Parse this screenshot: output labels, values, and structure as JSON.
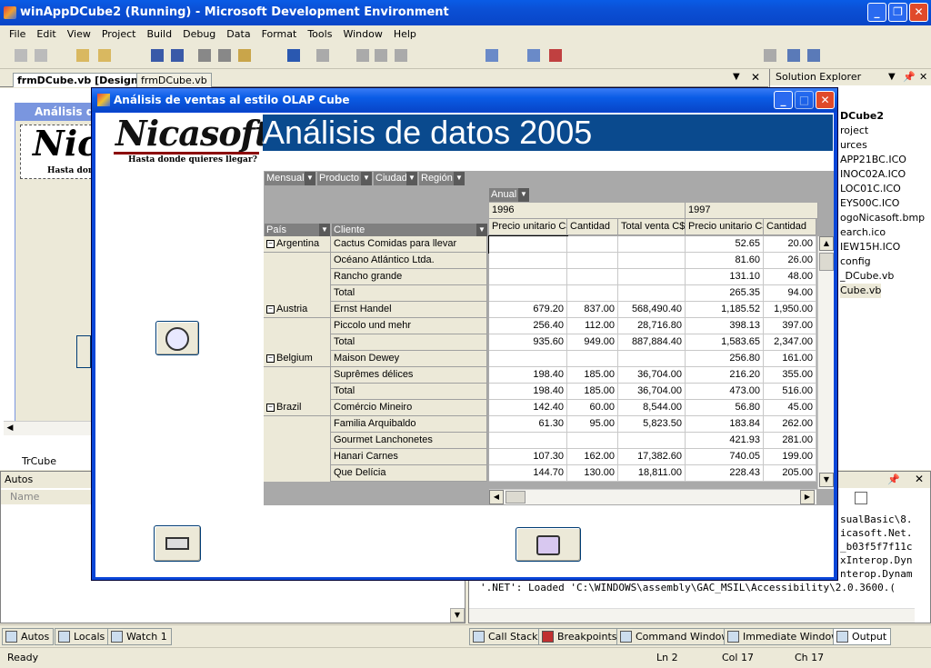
{
  "ide": {
    "title": "winAppDCube2 (Running) - Microsoft Development Environment",
    "menu": [
      "File",
      "Edit",
      "View",
      "Project",
      "Build",
      "Debug",
      "Data",
      "Format",
      "Tools",
      "Window",
      "Help"
    ],
    "doc_tabs": [
      "frmDCube.vb [Design]",
      "frmDCube.vb"
    ],
    "form_caption_partial": "Análisis d",
    "form_logo_partial": "Nic",
    "form_slogan_partial": "Hasta dond",
    "component": "TrCube"
  },
  "solution_explorer": {
    "title": "Solution Explorer",
    "items": [
      "DCube2",
      "roject",
      "urces",
      "APP21BC.ICO",
      "INOC02A.ICO",
      "LOC01C.ICO",
      "EYS00C.ICO",
      "ogoNicasoft.bmp",
      "earch.ico",
      "IEW15H.ICO",
      "config",
      "_DCube.vb",
      "Cube.vb"
    ]
  },
  "autos": {
    "title": "Autos",
    "column": "Name"
  },
  "output": {
    "lines": [
      "sualBasic\\8.",
      "icasoft.Net.",
      "_b03f5f7f11c",
      "xInterop.Dyn",
      "nterop.Dynam",
      "'.NET': Loaded 'C:\\WINDOWS\\assembly\\GAC_MSIL\\Accessibility\\2.0.3600.("
    ]
  },
  "bottom_tabs_left": [
    "Autos",
    "Locals",
    "Watch 1"
  ],
  "bottom_tabs_right": [
    "Call Stack",
    "Breakpoints",
    "Command Window",
    "Immediate Window",
    "Output"
  ],
  "status": {
    "text": "Ready",
    "ln": "Ln 2",
    "col": "Col 17",
    "ch": "Ch 17"
  },
  "dialog": {
    "title": "Análisis de ventas al estilo OLAP Cube",
    "logo": "Nicasoft",
    "slogan": "Hasta donde quieres llegar?",
    "banner": "Análisis de datos 2005"
  },
  "pivot": {
    "filter_fields": [
      "Mensual",
      "Producto",
      "Ciudad",
      "Región"
    ],
    "column_field": "Anual",
    "row_fields": [
      "País",
      "Cliente"
    ],
    "years": [
      "1996",
      "1997"
    ],
    "measures_1996": [
      "Precio unitario C$",
      "Cantidad",
      "Total venta C$"
    ],
    "measures_1997": [
      "Precio unitario C$",
      "Cantidad"
    ],
    "rows": [
      {
        "country": "Argentina",
        "client": "Cactus Comidas para llevar",
        "v": [
          "",
          "",
          "",
          "52.65",
          "20.00"
        ]
      },
      {
        "country": "",
        "client": "Océano Atlántico Ltda.",
        "v": [
          "",
          "",
          "",
          "81.60",
          "26.00"
        ]
      },
      {
        "country": "",
        "client": "Rancho grande",
        "v": [
          "",
          "",
          "",
          "131.10",
          "48.00"
        ]
      },
      {
        "country": "",
        "client": "Total",
        "v": [
          "",
          "",
          "",
          "265.35",
          "94.00"
        ]
      },
      {
        "country": "Austria",
        "client": "Ernst Handel",
        "v": [
          "679.20",
          "837.00",
          "568,490.40",
          "1,185.52",
          "1,950.00"
        ]
      },
      {
        "country": "",
        "client": "Piccolo und mehr",
        "v": [
          "256.40",
          "112.00",
          "28,716.80",
          "398.13",
          "397.00"
        ]
      },
      {
        "country": "",
        "client": "Total",
        "v": [
          "935.60",
          "949.00",
          "887,884.40",
          "1,583.65",
          "2,347.00"
        ]
      },
      {
        "country": "Belgium",
        "client": "Maison Dewey",
        "v": [
          "",
          "",
          "",
          "256.80",
          "161.00"
        ]
      },
      {
        "country": "",
        "client": "Suprêmes délices",
        "v": [
          "198.40",
          "185.00",
          "36,704.00",
          "216.20",
          "355.00"
        ]
      },
      {
        "country": "",
        "client": "Total",
        "v": [
          "198.40",
          "185.00",
          "36,704.00",
          "473.00",
          "516.00"
        ]
      },
      {
        "country": "Brazil",
        "client": "Comércio Mineiro",
        "v": [
          "142.40",
          "60.00",
          "8,544.00",
          "56.80",
          "45.00"
        ]
      },
      {
        "country": "",
        "client": "Familia Arquibaldo",
        "v": [
          "61.30",
          "95.00",
          "5,823.50",
          "183.84",
          "262.00"
        ]
      },
      {
        "country": "",
        "client": "Gourmet Lanchonetes",
        "v": [
          "",
          "",
          "",
          "421.93",
          "281.00"
        ]
      },
      {
        "country": "",
        "client": "Hanari Carnes",
        "v": [
          "107.30",
          "162.00",
          "17,382.60",
          "740.05",
          "199.00"
        ]
      },
      {
        "country": "",
        "client": "Que Delícia",
        "v": [
          "144.70",
          "130.00",
          "18,811.00",
          "228.43",
          "205.00"
        ]
      }
    ]
  }
}
